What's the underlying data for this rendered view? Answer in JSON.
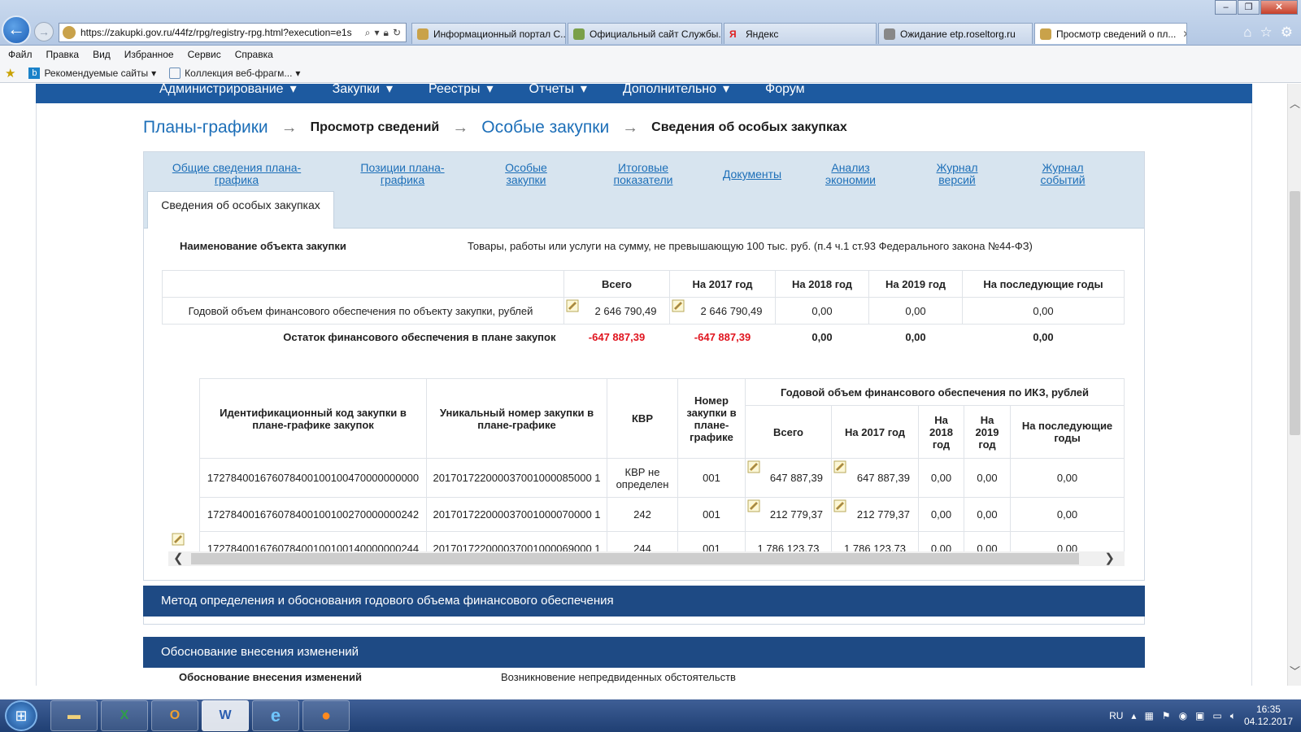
{
  "browser": {
    "url": "https://zakupki.gov.ru/44fz/rpg/registry-rpg.html?execution=e1s",
    "tabs": [
      {
        "label": "Информационный портал С...",
        "color": "#c9a24a",
        "active": false
      },
      {
        "label": "Официальный сайт Службы...",
        "color": "#7aa04a",
        "active": false
      },
      {
        "label": "Яндекс",
        "color": "#e02020",
        "active": false
      },
      {
        "label": "Ожидание etp.roseltorg.ru",
        "color": "#888888",
        "active": false
      },
      {
        "label": "Просмотр сведений о пл...",
        "color": "#c9a24a",
        "active": true
      }
    ],
    "menu": [
      "Файл",
      "Правка",
      "Вид",
      "Избранное",
      "Сервис",
      "Справка"
    ],
    "favorites": {
      "recommended": "Рекомендуемые сайты",
      "gallery": "Коллекция веб-фрагм..."
    }
  },
  "site": {
    "topnav": [
      "Администрирование",
      "Закупки",
      "Реестры",
      "Отчеты",
      "Дополнительно",
      "Форум"
    ],
    "breadcrumb": {
      "plans": "Планы-графики",
      "view": "Просмотр сведений",
      "special": "Особые закупки",
      "current": "Сведения об особых закупках"
    },
    "tabs": {
      "general": "Общие сведения плана-графика",
      "positions": "Позиции плана-графика",
      "special": "Особые закупки",
      "totals": "Итоговые показатели",
      "documents": "Документы",
      "economy": "Анализ экономии",
      "versions": "Журнал версий",
      "events": "Журнал событий",
      "active": "Сведения об особых закупках"
    },
    "object": {
      "label": "Наименование объекта закупки",
      "value": "Товары, работы или услуги на сумму, не превышающую 100 тыс. руб. (п.4 ч.1 ст.93 Федерального закона №44-ФЗ)"
    },
    "summary": {
      "headers": [
        "Всего",
        "На 2017 год",
        "На 2018 год",
        "На 2019 год",
        "На последующие годы"
      ],
      "row_label": "Годовой объем финансового обеспечения по объекту закупки, рублей",
      "row_values": [
        "2 646 790,49",
        "2 646 790,49",
        "0,00",
        "0,00",
        "0,00"
      ],
      "total_label": "Остаток финансового обеспечения в плане закупок",
      "total_values": [
        "-647 887,39",
        "-647 887,39",
        "0,00",
        "0,00",
        "0,00"
      ]
    },
    "ikz_table": {
      "h_code": "Идентификационный код закупки в плане-графике закупок",
      "h_unique": "Уникальный номер закупки в плане-графике",
      "h_kvr": "КВР",
      "h_num": "Номер закупки в плане-графике",
      "h_group": "Годовой объем финансового обеспечения по ИКЗ, рублей",
      "h_total": "Всего",
      "h_2017": "На 2017 год",
      "h_2018": "На 2018 год",
      "h_2019": "На 2019 год",
      "h_next": "На последующие годы",
      "rows": [
        {
          "code": "172784001676078400100100470000000000",
          "unique": "201701722000037001000085000 1",
          "kvr": "КВР не определен",
          "num": "001",
          "total": "647 887,39",
          "y2017": "647 887,39",
          "y2018": "0,00",
          "y2019": "0,00",
          "next": "0,00"
        },
        {
          "code": "172784001676078400100100270000000242",
          "unique": "201701722000037001000070000 1",
          "kvr": "242",
          "num": "001",
          "total": "212 779,37",
          "y2017": "212 779,37",
          "y2018": "0,00",
          "y2019": "0,00",
          "next": "0,00"
        },
        {
          "code": "172784001676078400100100140000000244",
          "unique": "201701722000037001000069000 1",
          "kvr": "244",
          "num": "001",
          "total": "1 786 123,73",
          "y2017": "1 786 123,73",
          "y2018": "0,00",
          "y2019": "0,00",
          "next": "0,00"
        }
      ]
    },
    "sections": {
      "method": "Метод определения и обоснования годового объема финансового обеспечения",
      "reason": "Обоснование внесения изменений",
      "reason_label": "Обоснование внесения изменений",
      "reason_value": "Возникновение непредвиденных обстоятельств"
    }
  },
  "taskbar": {
    "lang": "RU",
    "time": "16:35",
    "date": "04.12.2017"
  }
}
